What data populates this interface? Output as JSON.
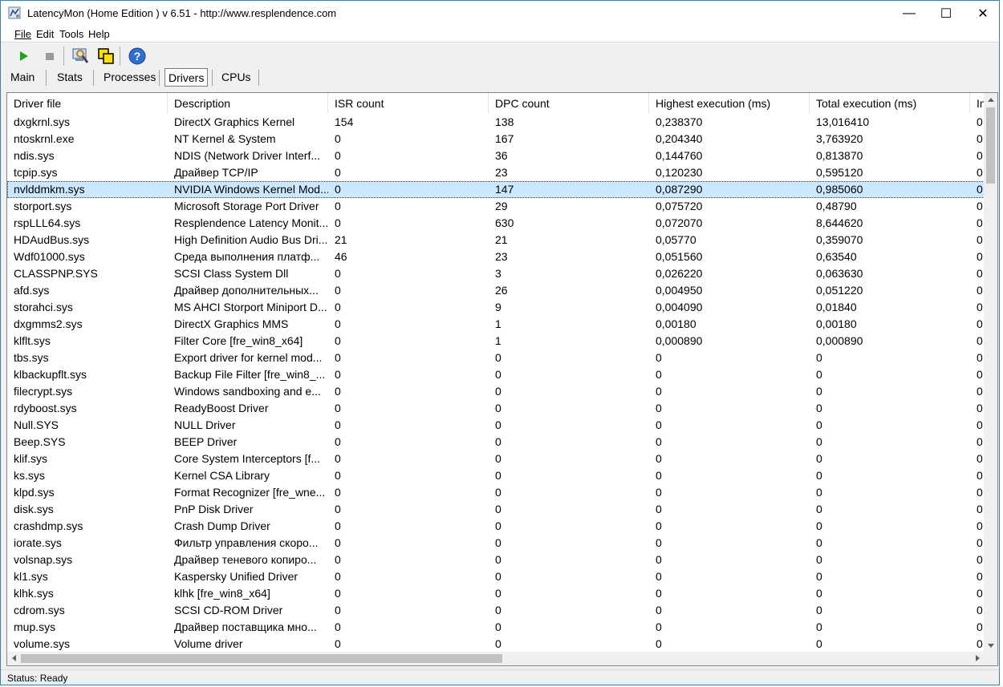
{
  "window": {
    "title": "LatencyMon  (Home Edition )  v 6.51 - http://www.resplendence.com",
    "minimize": "—",
    "maximize": "☐",
    "close": "✕"
  },
  "menu": [
    {
      "label": "File"
    },
    {
      "label": "Edit"
    },
    {
      "label": "Tools"
    },
    {
      "label": "Help"
    }
  ],
  "tabs": [
    {
      "label": "Main",
      "active": false
    },
    {
      "label": "Stats",
      "active": false
    },
    {
      "label": "Processes",
      "active": false
    },
    {
      "label": "Drivers",
      "active": true
    },
    {
      "label": "CPUs",
      "active": false
    }
  ],
  "table": {
    "columns": [
      "Driver file",
      "Description",
      "ISR count",
      "DPC count",
      "Highest execution (ms)",
      "Total execution (ms)",
      "In"
    ],
    "rows": [
      [
        "dxgkrnl.sys",
        "DirectX Graphics Kernel",
        "154",
        "138",
        "0,238370",
        "13,016410",
        "0"
      ],
      [
        "ntoskrnl.exe",
        "NT Kernel & System",
        "0",
        "167",
        "0,204340",
        "3,763920",
        "0"
      ],
      [
        "ndis.sys",
        "NDIS (Network Driver Interf...",
        "0",
        "36",
        "0,144760",
        "0,813870",
        "0"
      ],
      [
        "tcpip.sys",
        "Драйвер TCP/IP",
        "0",
        "23",
        "0,120230",
        "0,595120",
        "0"
      ],
      [
        "nvlddmkm.sys",
        "NVIDIA Windows Kernel Mod...",
        "0",
        "147",
        "0,087290",
        "0,985060",
        "0"
      ],
      [
        "storport.sys",
        "Microsoft Storage Port Driver",
        "0",
        "29",
        "0,075720",
        "0,48790",
        "0"
      ],
      [
        "rspLLL64.sys",
        "Resplendence Latency Monit...",
        "0",
        "630",
        "0,072070",
        "8,644620",
        "0"
      ],
      [
        "HDAudBus.sys",
        "High Definition Audio Bus Dri...",
        "21",
        "21",
        "0,05770",
        "0,359070",
        "0"
      ],
      [
        "Wdf01000.sys",
        "Среда выполнения платф...",
        "46",
        "23",
        "0,051560",
        "0,63540",
        "0"
      ],
      [
        "CLASSPNP.SYS",
        "SCSI Class System Dll",
        "0",
        "3",
        "0,026220",
        "0,063630",
        "0"
      ],
      [
        "afd.sys",
        "Драйвер дополнительных...",
        "0",
        "26",
        "0,004950",
        "0,051220",
        "0"
      ],
      [
        "storahci.sys",
        "MS AHCI Storport Miniport D...",
        "0",
        "9",
        "0,004090",
        "0,01840",
        "0"
      ],
      [
        "dxgmms2.sys",
        "DirectX Graphics MMS",
        "0",
        "1",
        "0,00180",
        "0,00180",
        "0"
      ],
      [
        "klflt.sys",
        "Filter Core [fre_win8_x64]",
        "0",
        "1",
        "0,000890",
        "0,000890",
        "0"
      ],
      [
        "tbs.sys",
        "Export driver for kernel mod...",
        "0",
        "0",
        "0",
        "0",
        "0"
      ],
      [
        "klbackupflt.sys",
        "Backup File Filter [fre_win8_...",
        "0",
        "0",
        "0",
        "0",
        "0"
      ],
      [
        "filecrypt.sys",
        "Windows sandboxing and e...",
        "0",
        "0",
        "0",
        "0",
        "0"
      ],
      [
        "rdyboost.sys",
        "ReadyBoost Driver",
        "0",
        "0",
        "0",
        "0",
        "0"
      ],
      [
        "Null.SYS",
        "NULL Driver",
        "0",
        "0",
        "0",
        "0",
        "0"
      ],
      [
        "Beep.SYS",
        "BEEP Driver",
        "0",
        "0",
        "0",
        "0",
        "0"
      ],
      [
        "klif.sys",
        "Core System Interceptors [f...",
        "0",
        "0",
        "0",
        "0",
        "0"
      ],
      [
        "ks.sys",
        "Kernel CSA Library",
        "0",
        "0",
        "0",
        "0",
        "0"
      ],
      [
        "klpd.sys",
        "Format Recognizer [fre_wne...",
        "0",
        "0",
        "0",
        "0",
        "0"
      ],
      [
        "disk.sys",
        "PnP Disk Driver",
        "0",
        "0",
        "0",
        "0",
        "0"
      ],
      [
        "crashdmp.sys",
        "Crash Dump Driver",
        "0",
        "0",
        "0",
        "0",
        "0"
      ],
      [
        "iorate.sys",
        "Фильтр управления скоро...",
        "0",
        "0",
        "0",
        "0",
        "0"
      ],
      [
        "volsnap.sys",
        "Драйвер теневого копиро...",
        "0",
        "0",
        "0",
        "0",
        "0"
      ],
      [
        "kl1.sys",
        "Kaspersky Unified Driver",
        "0",
        "0",
        "0",
        "0",
        "0"
      ],
      [
        "klhk.sys",
        "klhk [fre_win8_x64]",
        "0",
        "0",
        "0",
        "0",
        "0"
      ],
      [
        "cdrom.sys",
        "SCSI CD-ROM Driver",
        "0",
        "0",
        "0",
        "0",
        "0"
      ],
      [
        "mup.sys",
        "Драйвер поставщика мно...",
        "0",
        "0",
        "0",
        "0",
        "0"
      ],
      [
        "volume.sys",
        "Volume driver",
        "0",
        "0",
        "0",
        "0",
        "0"
      ]
    ],
    "selected_index": 4
  },
  "status": {
    "text": "Status: Ready"
  },
  "colors": {
    "selection": "#cce8ff",
    "window_border": "#3c7fb1"
  }
}
